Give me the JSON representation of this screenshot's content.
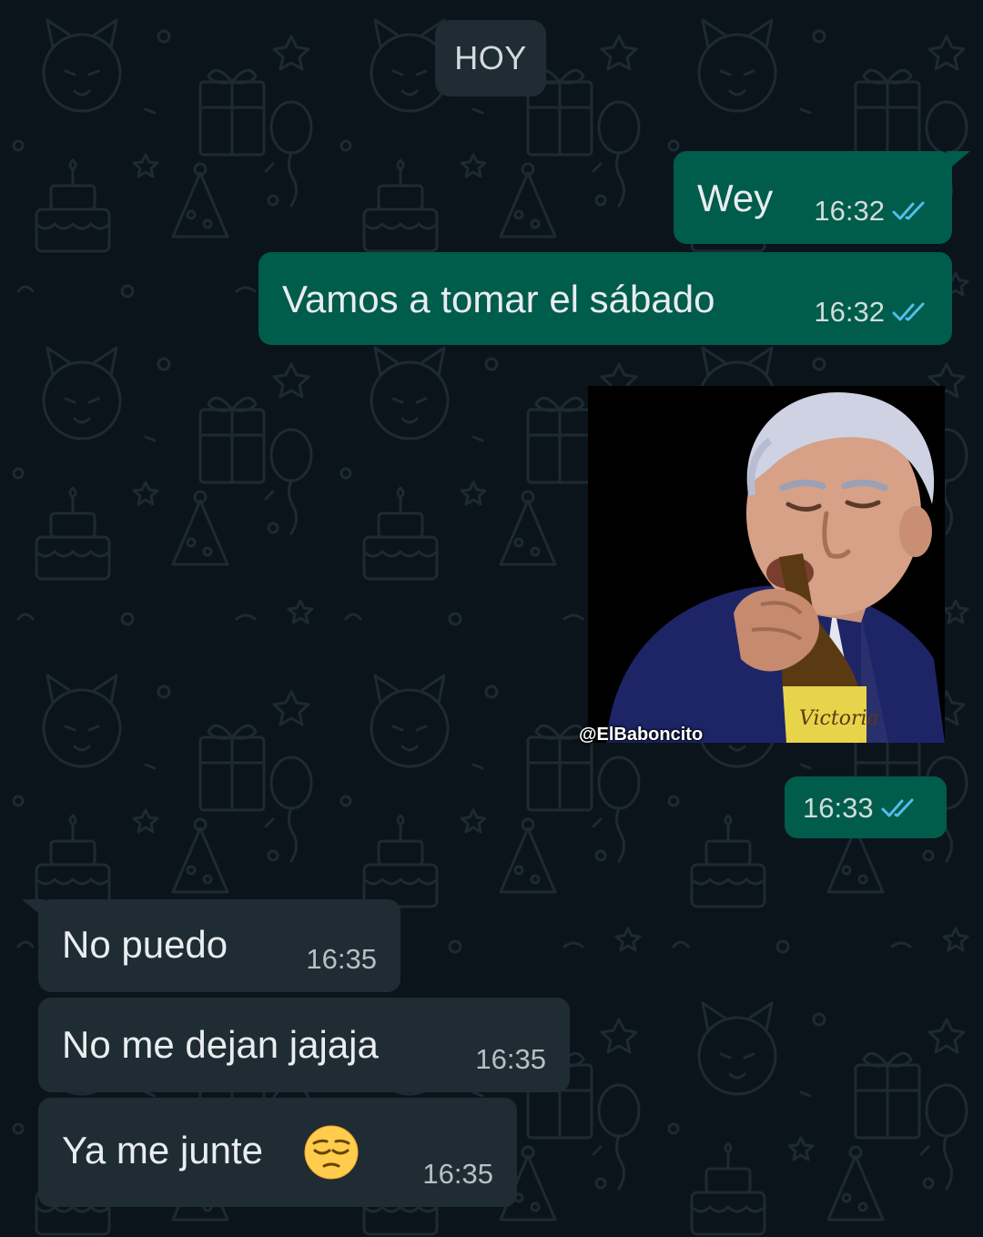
{
  "date_chip": "HOY",
  "colors": {
    "background": "#0b141a",
    "outgoing_bubble": "#005c4b",
    "incoming_bubble": "#1f2c33",
    "read_tick": "#53bdeb"
  },
  "messages": [
    {
      "direction": "outgoing",
      "text": "Wey",
      "time": "16:32",
      "status": "read"
    },
    {
      "direction": "outgoing",
      "text": "Vamos a tomar el sábado",
      "time": "16:32",
      "status": "read"
    },
    {
      "direction": "outgoing",
      "type": "sticker",
      "watermark": "@ElBaboncito",
      "bottle_label": "Victoria",
      "time": "16:33",
      "status": "read"
    },
    {
      "direction": "incoming",
      "text": "No puedo",
      "time": "16:35"
    },
    {
      "direction": "incoming",
      "text": "No me dejan jajaja",
      "time": "16:35"
    },
    {
      "direction": "incoming",
      "text": "Ya me junte",
      "emoji": "pensive-face-emoji",
      "time": "16:35"
    }
  ]
}
